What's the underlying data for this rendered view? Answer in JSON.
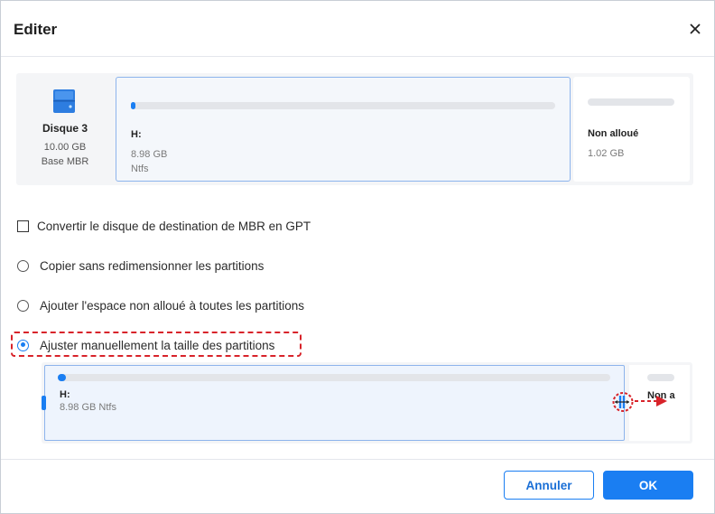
{
  "dialog": {
    "title": "Editer"
  },
  "disk": {
    "name": "Disque 3",
    "size": "10.00 GB",
    "type": "Base MBR"
  },
  "partition": {
    "label": "H:",
    "size": "8.98 GB",
    "fs": "Ntfs",
    "size_fs": "8.98 GB Ntfs",
    "used_fraction": 0.01
  },
  "unallocated": {
    "label": "Non alloué",
    "label_truncated": "Non a",
    "size": "1.02 GB"
  },
  "options": {
    "convert_gpt": "Convertir le disque de destination de MBR en GPT",
    "copy_no_resize": "Copier sans redimensionner les partitions",
    "add_unallocated": "Ajouter l'espace non alloué à toutes les partitions",
    "manual_resize": "Ajuster manuellement la taille des partitions",
    "selected": "manual_resize"
  },
  "buttons": {
    "cancel": "Annuler",
    "ok": "OK"
  },
  "colors": {
    "accent": "#1a7ef2",
    "highlight": "#d8232a"
  }
}
